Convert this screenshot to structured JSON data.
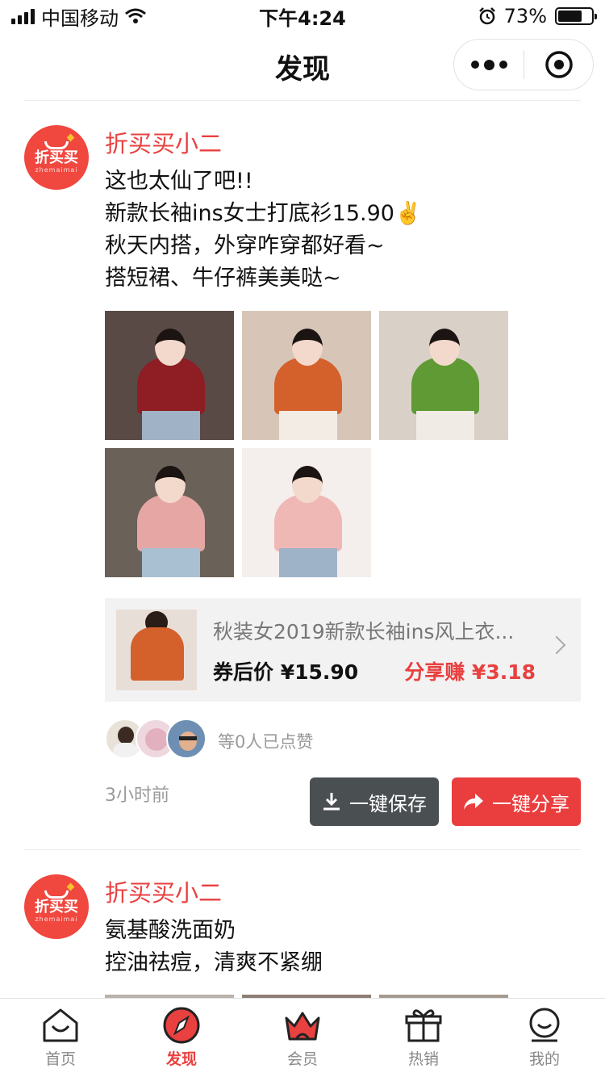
{
  "status_bar": {
    "carrier": "中国移动",
    "time": "下午4:24",
    "battery_percent": "73%",
    "battery_level": 0.73,
    "icons": [
      "signal-icon",
      "wifi-icon",
      "alarm-icon",
      "battery-icon"
    ]
  },
  "nav": {
    "title": "发现",
    "icons": [
      "more-icon",
      "close-circle-icon"
    ]
  },
  "posts": [
    {
      "avatar": {
        "name": "折买买",
        "sub": "zhemaimai"
      },
      "author": "折买买小二",
      "lines": [
        "这也太仙了吧!!",
        "新款长袖ins女士打底衫15.90✌️",
        "秋天内搭，外穿咋穿都好看~",
        "搭短裙、牛仔裤美美哒~"
      ],
      "photos": [
        {
          "shirt": "#8e1d24",
          "bg": "#5a4a45"
        },
        {
          "shirt": "#d4612c",
          "bg": "#d7c6b7"
        },
        {
          "shirt": "#5f9a34",
          "bg": "#d9d0c7"
        },
        {
          "shirt": "#e6a7a4",
          "bg": "#6a6158"
        },
        {
          "shirt": "#efb8b5",
          "bg": "#f4efec"
        }
      ],
      "product": {
        "title": "秋装女2019新款长袖ins风上衣...",
        "price": "券后价 ¥15.90",
        "earn": "分享赚 ¥3.18"
      },
      "likes_text": "等0人已点赞",
      "time": "3小时前",
      "save_label": "一键保存",
      "share_label": "一键分享"
    },
    {
      "avatar": {
        "name": "折买买",
        "sub": "zhemaimai"
      },
      "author": "折买买小二",
      "lines": [
        "氨基酸洗面奶",
        "控油祛痘，清爽不紧绷"
      ]
    }
  ],
  "tabs": [
    {
      "label": "首页",
      "icon": "home-icon",
      "active": false
    },
    {
      "label": "发现",
      "icon": "compass-icon",
      "active": true
    },
    {
      "label": "会员",
      "icon": "crown-icon",
      "active": false
    },
    {
      "label": "热销",
      "icon": "gift-icon",
      "active": false
    },
    {
      "label": "我的",
      "icon": "user-icon",
      "active": false
    }
  ],
  "colors": {
    "accent": "#e94040",
    "save_button": "#4a4f52",
    "share_button": "#ea3d3e"
  }
}
